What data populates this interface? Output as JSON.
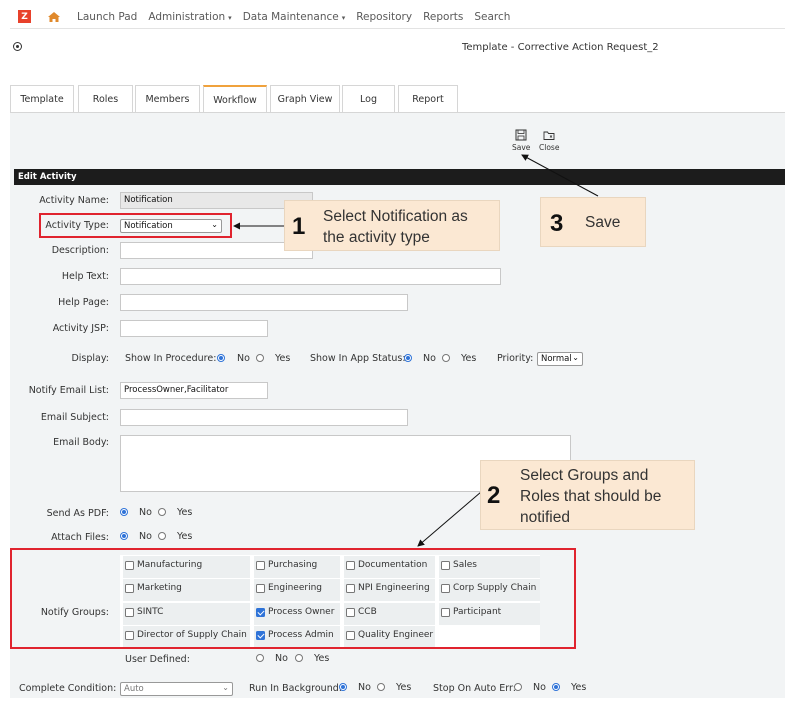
{
  "nav": {
    "logo": "Z",
    "items": [
      "Launch Pad",
      "Administration",
      "Data Maintenance",
      "Repository",
      "Reports",
      "Search"
    ]
  },
  "doc_title": "Template - Corrective Action Request_2",
  "tabs": [
    "Template",
    "Roles",
    "Members",
    "Workflow",
    "Graph View",
    "Log",
    "Report"
  ],
  "active_tab": "Workflow",
  "toolbar": {
    "save_label": "Save",
    "close_label": "Close"
  },
  "section_title": "Edit Activity",
  "form": {
    "activity_name_label": "Activity Name:",
    "activity_name_value": "Notification",
    "activity_type_label": "Activity Type:",
    "activity_type_value": "Notification",
    "description_label": "Description:",
    "help_text_label": "Help Text:",
    "help_page_label": "Help Page:",
    "activity_jsp_label": "Activity JSP:",
    "display_label": "Display:",
    "show_in_procedure_label": "Show In Procedure:",
    "show_in_app_status_label": "Show In App Status:",
    "priority_label": "Priority:",
    "priority_value": "Normal",
    "no_label": "No",
    "yes_label": "Yes",
    "notify_email_list_label": "Notify Email List:",
    "notify_email_list_value": "ProcessOwner,Facilitator",
    "email_subject_label": "Email Subject:",
    "email_body_label": "Email Body:",
    "send_as_pdf_label": "Send As PDF:",
    "attach_files_label": "Attach Files:",
    "notify_groups_label": "Notify Groups:",
    "user_defined_label": "User Defined:",
    "complete_condition_label": "Complete Condition:",
    "complete_condition_value": "Auto",
    "run_in_background_label": "Run In Background:",
    "stop_on_auto_err_label": "Stop On Auto Err:"
  },
  "groups": [
    {
      "label": "Manufacturing",
      "checked": false
    },
    {
      "label": "Purchasing",
      "checked": false
    },
    {
      "label": "Documentation",
      "checked": false
    },
    {
      "label": "Sales",
      "checked": false
    },
    {
      "label": "Marketing",
      "checked": false
    },
    {
      "label": "Engineering",
      "checked": false
    },
    {
      "label": "NPI Engineering",
      "checked": false
    },
    {
      "label": "Corp Supply Chain",
      "checked": false
    },
    {
      "label": "SINTC",
      "checked": false
    },
    {
      "label": "Process Owner",
      "checked": true
    },
    {
      "label": "CCB",
      "checked": false
    },
    {
      "label": "Participant",
      "checked": false
    },
    {
      "label": "Director of Supply Chain",
      "checked": false
    },
    {
      "label": "Process Admin",
      "checked": true
    },
    {
      "label": "Quality Engineer",
      "checked": false
    }
  ],
  "callouts": [
    {
      "number": "1",
      "text_line1": "Select Notification as",
      "text_line2": "the activity type"
    },
    {
      "number": "2",
      "text_line1": "Select Groups and",
      "text_line2": "Roles that should be",
      "text_line3": "notified"
    },
    {
      "number": "3",
      "text_line1": "Save"
    }
  ],
  "colors": {
    "brand": "#e8412b",
    "active_tab_accent": "#f0a23c",
    "highlight_red": "#e0232e",
    "callout_bg": "#fbe8d3",
    "radio_blue": "#2f73d8"
  }
}
